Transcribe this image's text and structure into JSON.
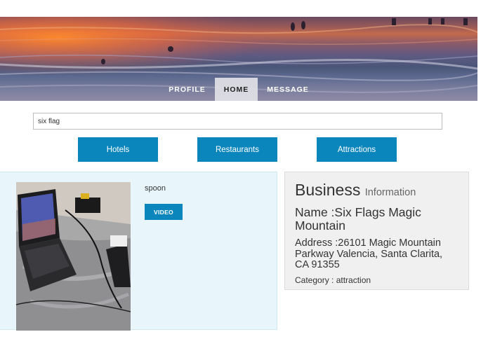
{
  "nav": {
    "items": [
      {
        "label": "PROFILE",
        "active": false
      },
      {
        "label": "HOME",
        "active": true
      },
      {
        "label": "MESSAGE",
        "active": false
      }
    ]
  },
  "search": {
    "value": "six flag",
    "placeholder": ""
  },
  "categories": {
    "hotels": "Hotels",
    "restaurants": "Restaurants",
    "attractions": "Attractions"
  },
  "result": {
    "title": "spoon",
    "video_label": "VIDEO"
  },
  "business": {
    "heading": "Business",
    "heading_sub": "Information",
    "name": "Name :Six Flags Magic Mountain",
    "address": "Address :26101 Magic Mountain Parkway Valencia, Santa Clarita, CA 91355",
    "category": "Category : attraction"
  },
  "colors": {
    "accent": "#0a86bd",
    "result_bg": "#e8f6fc",
    "info_bg": "#f0f0f0"
  }
}
